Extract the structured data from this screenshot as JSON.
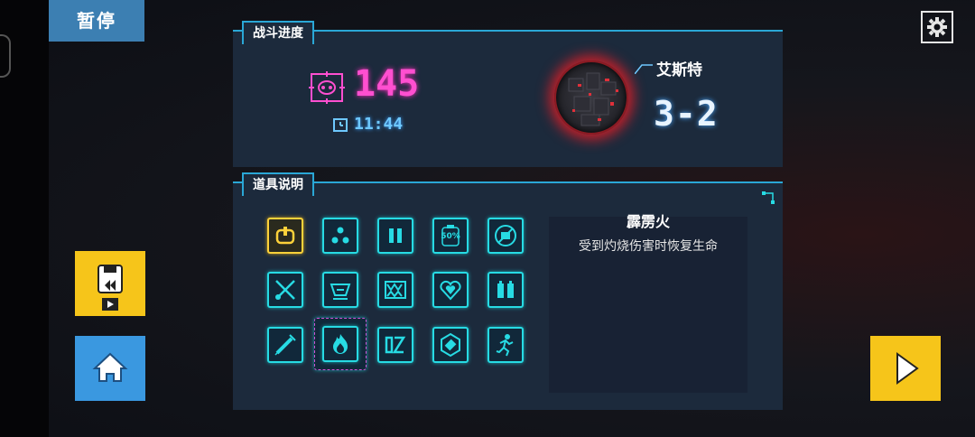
{
  "pause": {
    "label": "暂停"
  },
  "icons": {
    "settings": "gear-icon",
    "left_edge": "hexagon-edge-icon"
  },
  "battle_panel": {
    "title": "战斗进度",
    "score": "145",
    "time": "11:44",
    "boss_name": "艾斯特",
    "level": "3-2"
  },
  "items_panel": {
    "title": "道具说明",
    "selected_item": {
      "name": "霹雳火",
      "description": "受到灼烧伤害时恢复生命"
    },
    "items": [
      {
        "icon": "power-plug-icon",
        "highlight": "yellow"
      },
      {
        "icon": "three-dots-icon"
      },
      {
        "icon": "pause-bars-icon"
      },
      {
        "icon": "fifty-percent-bottle-icon",
        "text": "50%"
      },
      {
        "icon": "no-ammo-icon"
      },
      {
        "icon": "crossed-tools-icon"
      },
      {
        "icon": "boss-face-icon"
      },
      {
        "icon": "fangs-icon"
      },
      {
        "icon": "heart-icon"
      },
      {
        "icon": "vests-icon"
      },
      {
        "icon": "syringe-icon"
      },
      {
        "icon": "flame-icon",
        "selected": true
      },
      {
        "icon": "dz-glyph-icon"
      },
      {
        "icon": "hexagon-ammo-icon"
      },
      {
        "icon": "running-man-icon"
      }
    ]
  },
  "colors": {
    "accent_cyan": "#27dbe4",
    "score_pink": "#ff4fd0",
    "pause_blue": "#3c7fb2",
    "button_yellow": "#f6c51a",
    "home_blue": "#3a98e0"
  },
  "buttons": {
    "replay": "video-replay-icon",
    "home": "home-icon",
    "play": "play-icon"
  }
}
